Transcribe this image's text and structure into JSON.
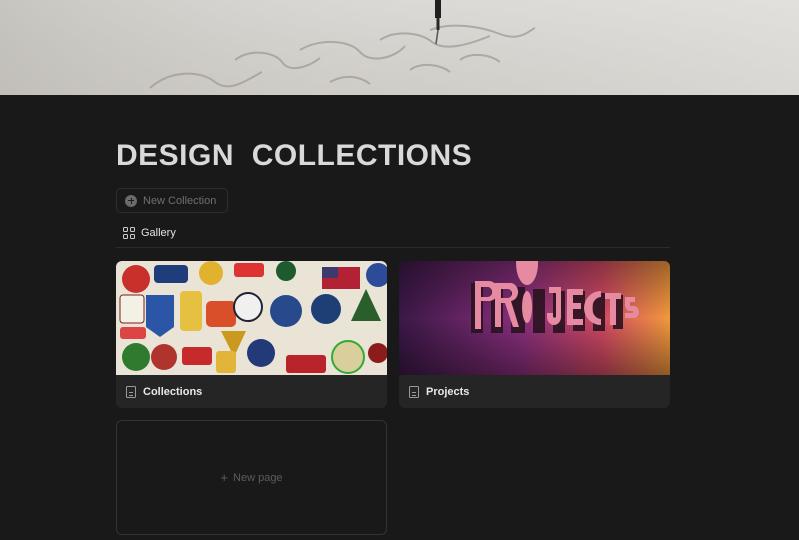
{
  "page": {
    "title": "DESIGN  COLLECTIONS",
    "new_collection_label": "New Collection",
    "view_tab_label": "Gallery",
    "new_page_label": "New page",
    "new_page_plus": "+"
  },
  "gallery": {
    "cards": [
      {
        "title": "Collections",
        "thumbnail": "patches-photo"
      },
      {
        "title": "Projects",
        "thumbnail": "projects-3d-letters"
      }
    ]
  },
  "cover": {
    "image": "pen-drawing-sketch"
  },
  "colors": {
    "background": "#191919",
    "card": "#252525",
    "text": "#d4d4d4"
  }
}
